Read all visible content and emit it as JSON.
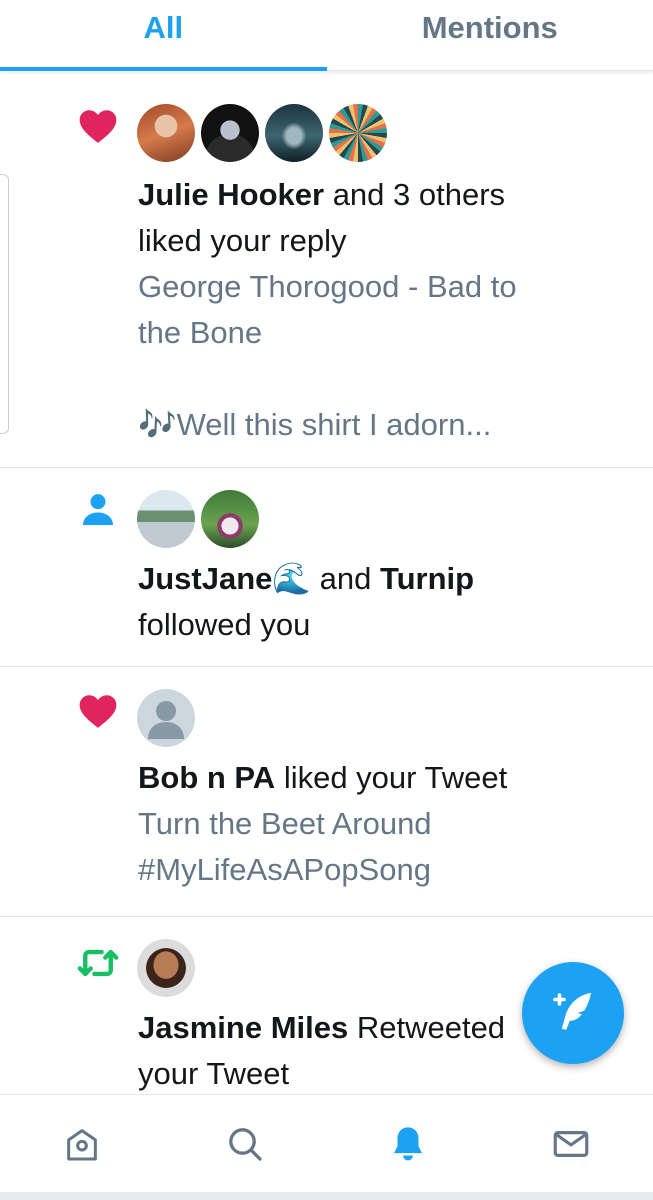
{
  "tabs": [
    {
      "label": "All",
      "active": true
    },
    {
      "label": "Mentions",
      "active": false
    }
  ],
  "notifications": [
    {
      "type": "like",
      "icon": "heart-icon",
      "actor": "Julie Hooker",
      "action_line1": "and 3 others",
      "action_line2": "liked your reply",
      "preview_line1": "George Thorogood - Bad to",
      "preview_line2": "the Bone",
      "preview_line3": "🎶Well this shirt I adorn..."
    },
    {
      "type": "follow",
      "icon": "person-icon",
      "actor1": "JustJane🌊",
      "joiner": "and",
      "actor2": "Turnip",
      "action": "followed you"
    },
    {
      "type": "like",
      "icon": "heart-icon",
      "actor": "Bob n PA",
      "action": "liked your Tweet",
      "preview_line1": "Turn the Beet Around",
      "preview_line2": "#MyLifeAsAPopSong"
    },
    {
      "type": "retweet",
      "icon": "retweet-icon",
      "actor": "Jasmine Miles",
      "action_line1": "Retweeted",
      "action_line2": "your Tweet"
    }
  ],
  "bottom_nav": [
    {
      "icon": "home-icon",
      "active": false
    },
    {
      "icon": "search-icon",
      "active": false
    },
    {
      "icon": "bell-icon",
      "active": true
    },
    {
      "icon": "mail-icon",
      "active": false
    }
  ],
  "colors": {
    "accent": "#1da1f2",
    "like": "#e0245e",
    "retweet": "#17bf63",
    "secondary_text": "#657786"
  }
}
